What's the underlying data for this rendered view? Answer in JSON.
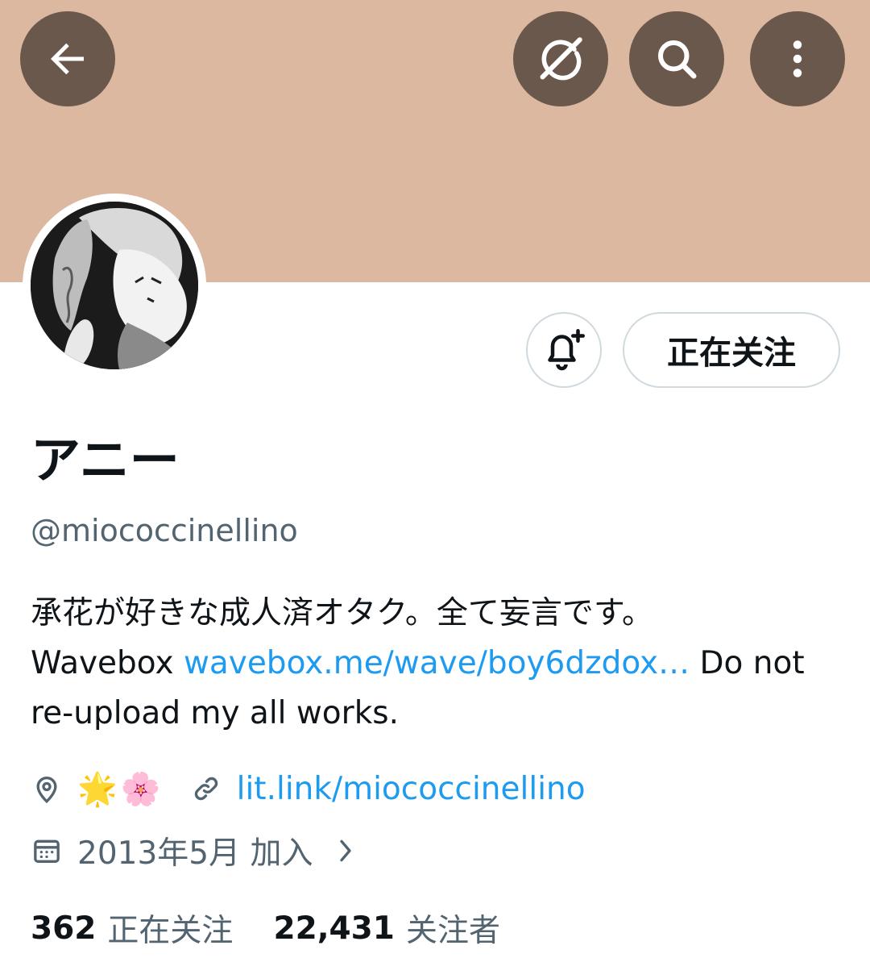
{
  "top_bar": {
    "back_icon": "arrow-left-icon",
    "grok_icon": "grok-icon",
    "search_icon": "search-icon",
    "more_icon": "more-vertical-icon",
    "overlay_color": "#6b584d"
  },
  "banner": {
    "color": "#dcb8a0"
  },
  "profile": {
    "display_name": "アニー",
    "handle": "@miococcinellino",
    "follow_button_label": "正在关注",
    "notify_icon": "bell-plus-icon",
    "bio_line1": "承花が好きな成人済オタク。全て妄言です。",
    "bio_prefix": "Wavebox ",
    "bio_link": "wavebox.me/wave/boy6dzdox…",
    "bio_suffix": " Do not",
    "bio_line3": "re-upload my all works.",
    "location_emoji_1": "🌟",
    "location_emoji_2": "🌸",
    "website": "lit.link/miococcinellino",
    "joined": "2013年5月 加入",
    "following_count": "362",
    "following_label": "正在关注",
    "followers_count": "22,431",
    "followers_label": "关注者"
  },
  "colors": {
    "link": "#1d9bf0",
    "secondary_text": "#536471",
    "primary_text": "#0f1419"
  }
}
